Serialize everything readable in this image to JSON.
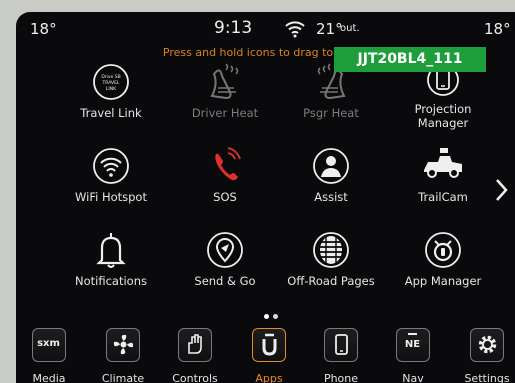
{
  "status": {
    "temp_left": "18°",
    "time": "9:13",
    "outside_temp": "21°",
    "outside_unit": "out.",
    "temp_right": "18°"
  },
  "hint": "Press and hold icons to drag to menu",
  "badge": "JJT20BL4_111",
  "apps": [
    {
      "label": "Travel Link",
      "icon": "travel-link-icon",
      "icon_text": "Drive SB TRAVEL LINK",
      "enabled": true
    },
    {
      "label": "Driver Heat",
      "icon": "driver-seat-heat-icon",
      "enabled": false
    },
    {
      "label": "Psgr Heat",
      "icon": "passenger-seat-heat-icon",
      "enabled": false
    },
    {
      "label": "Projection Manager",
      "label_line1": "Projection",
      "label_line2": "Manager",
      "icon": "projection-phone-icon",
      "enabled": true
    },
    {
      "label": "WiFi Hotspot",
      "icon": "wifi-icon",
      "enabled": true
    },
    {
      "label": "SOS",
      "icon": "phone-sos-icon",
      "enabled": true
    },
    {
      "label": "Assist",
      "icon": "assist-person-icon",
      "enabled": true
    },
    {
      "label": "TrailCam",
      "icon": "trailcam-truck-icon",
      "enabled": true
    },
    {
      "label": "Notifications",
      "icon": "bell-icon",
      "enabled": true
    },
    {
      "label": "Send & Go",
      "icon": "send-and-go-pin-icon",
      "enabled": true
    },
    {
      "label": "Off-Road Pages",
      "icon": "tire-icon",
      "enabled": true
    },
    {
      "label": "App Manager",
      "icon": "app-manager-icon",
      "enabled": true
    }
  ],
  "dock": [
    {
      "label": "Media",
      "icon": "sxm-icon",
      "icon_text": "sxm"
    },
    {
      "label": "Climate",
      "icon": "climate-icon"
    },
    {
      "label": "Controls",
      "icon": "controls-icon"
    },
    {
      "label": "Apps",
      "icon": "apps-icon",
      "active": true
    },
    {
      "label": "Phone",
      "icon": "phone-icon"
    },
    {
      "label": "Nav",
      "icon": "nav-compass-icon",
      "icon_text": "NE"
    },
    {
      "label": "Settings",
      "icon": "gear-icon"
    }
  ],
  "pager": {
    "pages": 2,
    "current": 1
  },
  "colors": {
    "accent": "#e58a2a",
    "sos_red": "#e0322b",
    "hint": "#d98224",
    "badge": "#1e9e3a"
  }
}
